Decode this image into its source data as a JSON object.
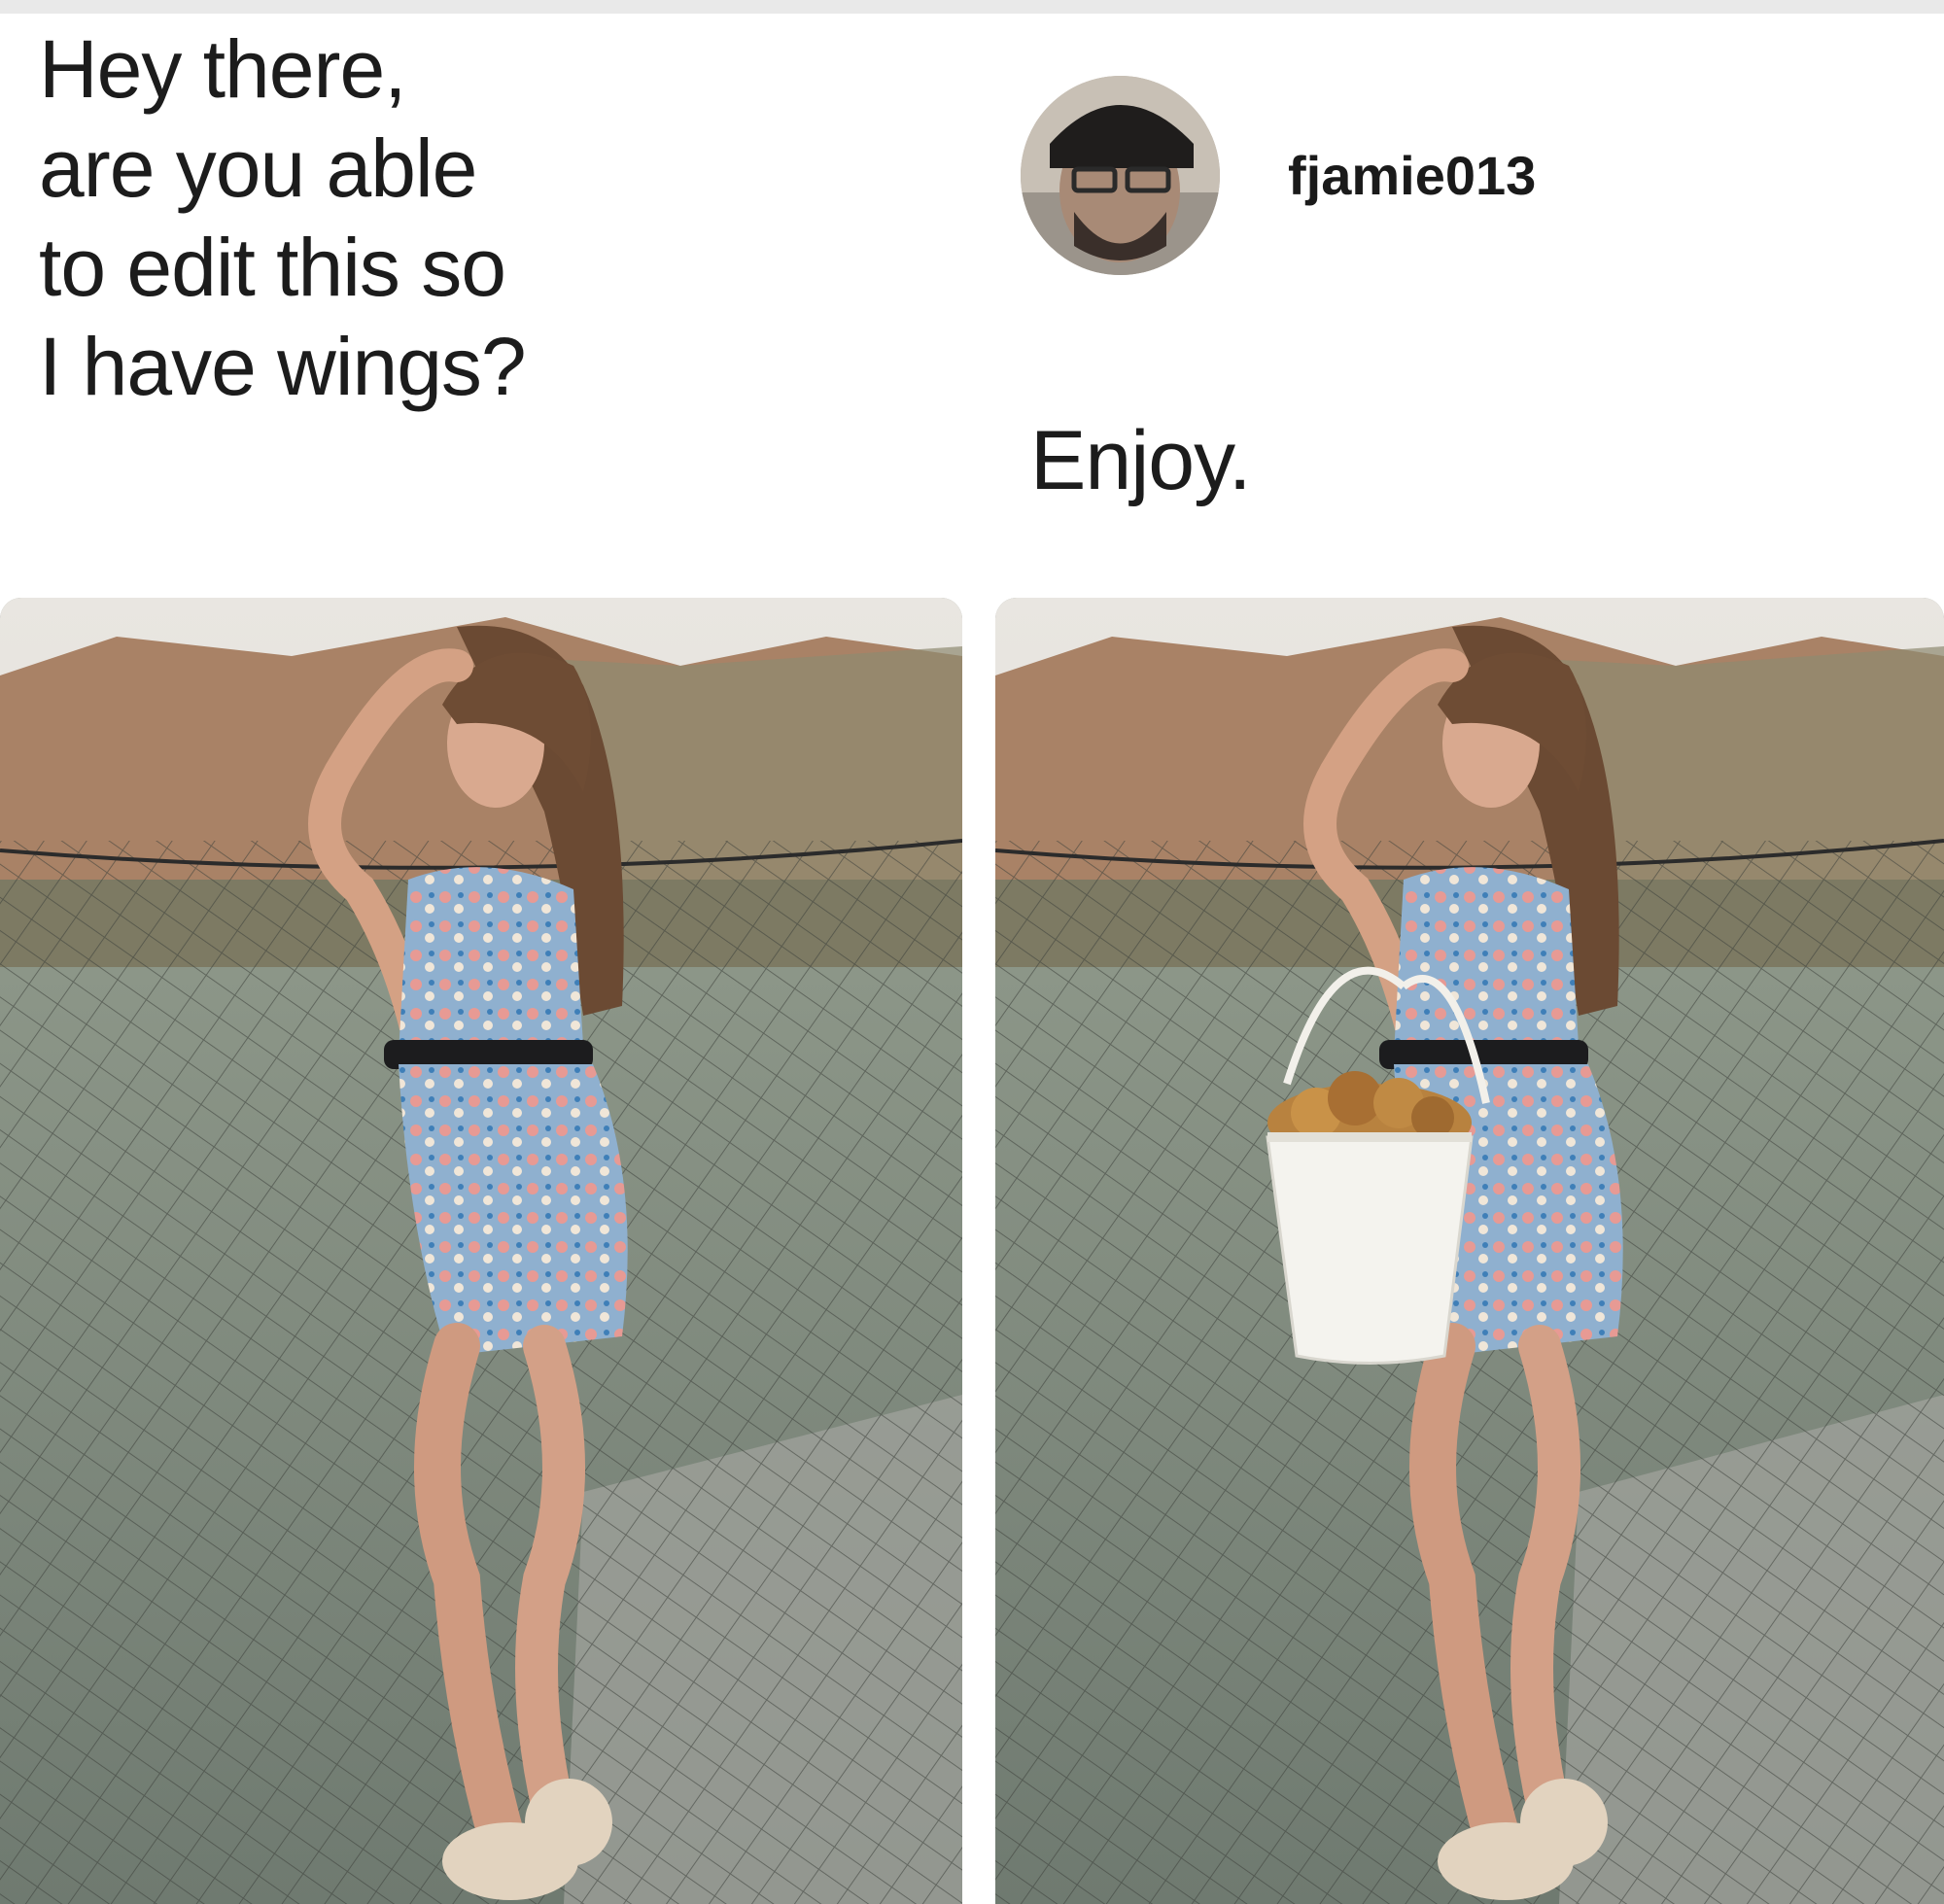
{
  "request": {
    "lines": [
      "Hey there,",
      "are you able",
      "to edit this so",
      "I have wings?"
    ]
  },
  "reply": {
    "username": "fjamie013",
    "message": "Enjoy.",
    "avatar_icon": "profile-avatar-icon"
  },
  "images": [
    {
      "name": "original-photo",
      "description_icon": "woman-on-net-bridge-image"
    },
    {
      "name": "edited-photo",
      "description_icon": "woman-with-chicken-bucket-image"
    }
  ],
  "colors": {
    "text": "#1c1c1c",
    "background": "#ffffff"
  }
}
